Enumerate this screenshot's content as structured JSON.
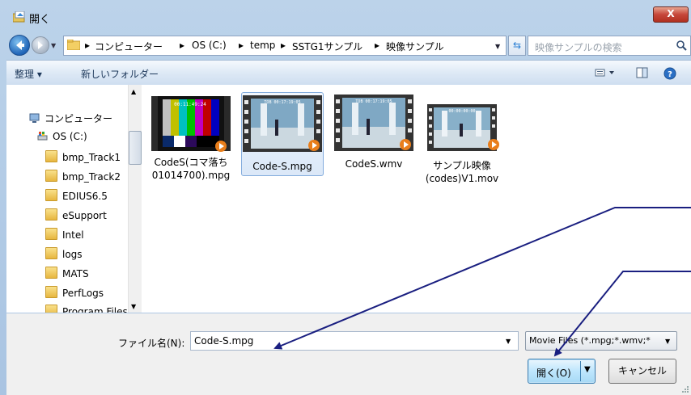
{
  "window": {
    "title": "開く",
    "close_label": "X"
  },
  "address": {
    "breadcrumbs": [
      "コンピューター",
      "OS (C:)",
      "temp",
      "SSTG1サンプル",
      "映像サンプル"
    ],
    "separator": "▸",
    "search_placeholder": "映像サンプルの検索"
  },
  "toolbar": {
    "organize_label": "整理 ▾",
    "new_folder_label": "新しいフォルダー"
  },
  "sidebar": {
    "root_label": "コンピューター",
    "drive_label": "OS (C:)",
    "folders": [
      "bmp_Track1",
      "bmp_Track2",
      "EDIUS6.5",
      "eSupport",
      "Intel",
      "logs",
      "MATS",
      "PerfLogs",
      "Program Files"
    ]
  },
  "files": [
    {
      "name_line1": "CodeS(コマ落ち",
      "name_line2": "01014700).mpg",
      "thumb": "color-bars",
      "selected": false,
      "overlay": "00:11:49:24"
    },
    {
      "name_line1": "Code-S.mpg",
      "name_line2": "",
      "thumb": "video-hall",
      "selected": true,
      "overlay": "TOB 00:17:19:05"
    },
    {
      "name_line1": "CodeS.wmv",
      "name_line2": "",
      "thumb": "video-hall",
      "selected": false,
      "overlay": "TOB 00:17:19:05"
    },
    {
      "name_line1": "サンプル映像",
      "name_line2": "(codes)V1.mov",
      "thumb": "video-hall",
      "selected": false,
      "overlay": "00:00:00:00"
    }
  ],
  "bottom": {
    "filename_label": "ファイル名(N):",
    "filename_value": "Code-S.mpg",
    "filetype_value": "Movie Files (*.mpg;*.wmv;*",
    "open_label": "開く(O)",
    "cancel_label": "キャンセル"
  },
  "colors": {
    "annotation": "#1a1f80",
    "accent": "#2a7fd4"
  }
}
